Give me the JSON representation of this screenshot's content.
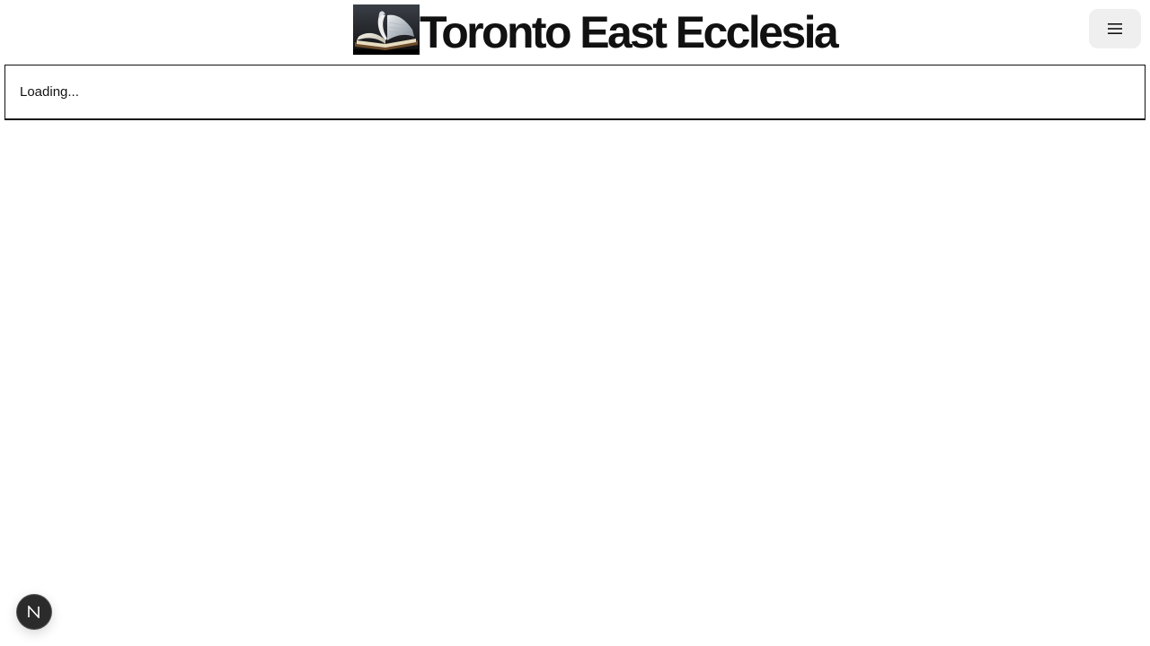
{
  "header": {
    "title": "Toronto East Ecclesia",
    "menu_icon": "hamburger-menu-icon"
  },
  "main": {
    "status_text": "Loading..."
  },
  "dev_badge": {
    "icon": "nextjs-logo-icon"
  },
  "colors": {
    "text": "#111111",
    "menu_button_bg": "#efefef",
    "badge_bg": "#2b2b2b",
    "border": "#111111"
  }
}
